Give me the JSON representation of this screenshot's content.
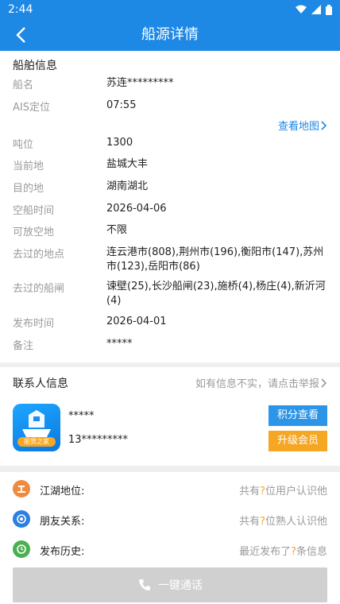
{
  "statusbar": {
    "time": "2:44"
  },
  "appbar": {
    "title": "船源详情"
  },
  "ship": {
    "section_title": "船舶信息",
    "map_link": "查看地图",
    "rows": [
      {
        "key": "船名",
        "value": "苏连*********"
      },
      {
        "key": "AIS定位",
        "value": "07:55"
      },
      {
        "key": "吨位",
        "value": "1300"
      },
      {
        "key": "当前地",
        "value": "盐城大丰"
      },
      {
        "key": "目的地",
        "value": "湖南湖北"
      },
      {
        "key": "空船时间",
        "value": "2026-04-06"
      },
      {
        "key": "可放空地",
        "value": "不限"
      },
      {
        "key": "去过的地点",
        "value": "连云港市(808),荆州市(196),衡阳市(147),苏州市(123),岳阳市(86)"
      },
      {
        "key": "去过的船闸",
        "value": "谏壁(25),长沙船闸(23),施桥(4),杨庄(4),新沂河(4)"
      },
      {
        "key": "发布时间",
        "value": "2026-04-01"
      },
      {
        "key": "备注",
        "value": "*****"
      }
    ]
  },
  "contact": {
    "section_title": "联系人信息",
    "report": "如有信息不实，请点击举报",
    "logo_text": "船货之家",
    "name": "*****",
    "phone": "13*********",
    "btn_points": "积分查看",
    "btn_upgrade": "升级会员"
  },
  "info": {
    "rows": [
      {
        "label": "江湖地位:",
        "pre": "共有",
        "q": "?",
        "post": "位用户认识他",
        "color": "#f08a3c"
      },
      {
        "label": "朋友关系:",
        "pre": "共有",
        "q": "?",
        "post": "位熟人认识他",
        "color": "#2d7fe0"
      },
      {
        "label": "发布历史:",
        "pre": "最近发布了",
        "q": "?",
        "post": "条信息",
        "color": "#4caf50"
      }
    ]
  },
  "call": {
    "label": "一键通话"
  }
}
